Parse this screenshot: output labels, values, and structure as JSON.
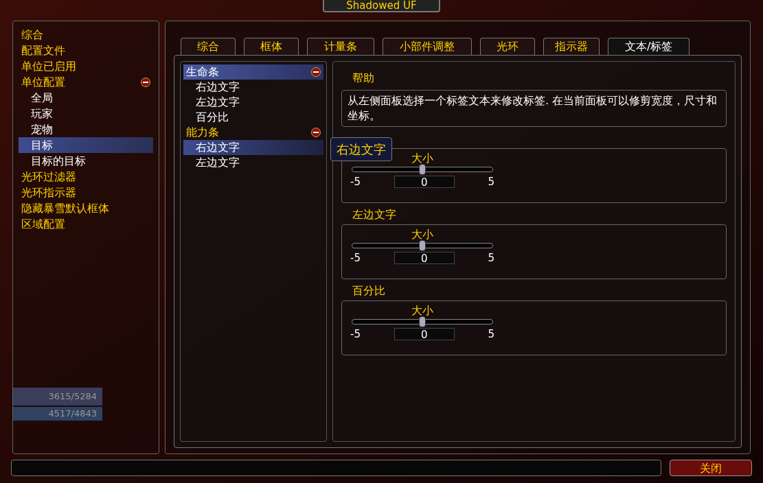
{
  "window": {
    "title": "Shadowed UF"
  },
  "sidebar": {
    "items": [
      {
        "label": "综合",
        "selected": false
      },
      {
        "label": "配置文件",
        "selected": false
      },
      {
        "label": "单位已启用",
        "selected": false
      },
      {
        "label": "单位配置",
        "selected": false,
        "expanded": true,
        "children": [
          {
            "label": "全局",
            "selected": false
          },
          {
            "label": "玩家",
            "selected": false
          },
          {
            "label": "宠物",
            "selected": false
          },
          {
            "label": "目标",
            "selected": true
          },
          {
            "label": "目标的目标",
            "selected": false
          }
        ]
      },
      {
        "label": "光环过滤器",
        "selected": false
      },
      {
        "label": "光环指示器",
        "selected": false
      },
      {
        "label": "隐藏暴雪默认框体",
        "selected": false
      },
      {
        "label": "区域配置",
        "selected": false
      }
    ]
  },
  "background_unit_frame": {
    "health": "3615/5284",
    "power": "4517/4843"
  },
  "tabs": [
    {
      "label": "综合",
      "selected": false
    },
    {
      "label": "框体",
      "selected": false
    },
    {
      "label": "计量条",
      "selected": false
    },
    {
      "label": "小部件调整",
      "selected": false
    },
    {
      "label": "光环",
      "selected": false
    },
    {
      "label": "指示器",
      "selected": false
    },
    {
      "label": "文本/标签",
      "selected": true
    }
  ],
  "tree": [
    {
      "label": "生命条",
      "expanded": true,
      "selected": true,
      "children": [
        {
          "label": "右边文字",
          "selected": false
        },
        {
          "label": "左边文字",
          "selected": false
        },
        {
          "label": "百分比",
          "selected": false
        }
      ]
    },
    {
      "label": "能力条",
      "expanded": true,
      "selected": false,
      "children": [
        {
          "label": "右边文字",
          "selected": true
        },
        {
          "label": "左边文字",
          "selected": false
        }
      ]
    }
  ],
  "help": {
    "title": "帮助",
    "text": "从左侧面板选择一个标签文本来修改标签. 在当前面板可以修剪宽度，尺寸和坐标。"
  },
  "tooltip": "右边文字",
  "groups": [
    {
      "slider": {
        "label": "大小",
        "min": "-5",
        "max": "5",
        "value": "0",
        "level": 0.5
      }
    },
    {
      "title": "左边文字",
      "slider": {
        "label": "大小",
        "min": "-5",
        "max": "5",
        "value": "0",
        "level": 0.5
      }
    },
    {
      "title": "百分比",
      "slider": {
        "label": "大小",
        "min": "-5",
        "max": "5",
        "value": "0",
        "level": 0.5
      }
    }
  ],
  "close_button": "关闭"
}
